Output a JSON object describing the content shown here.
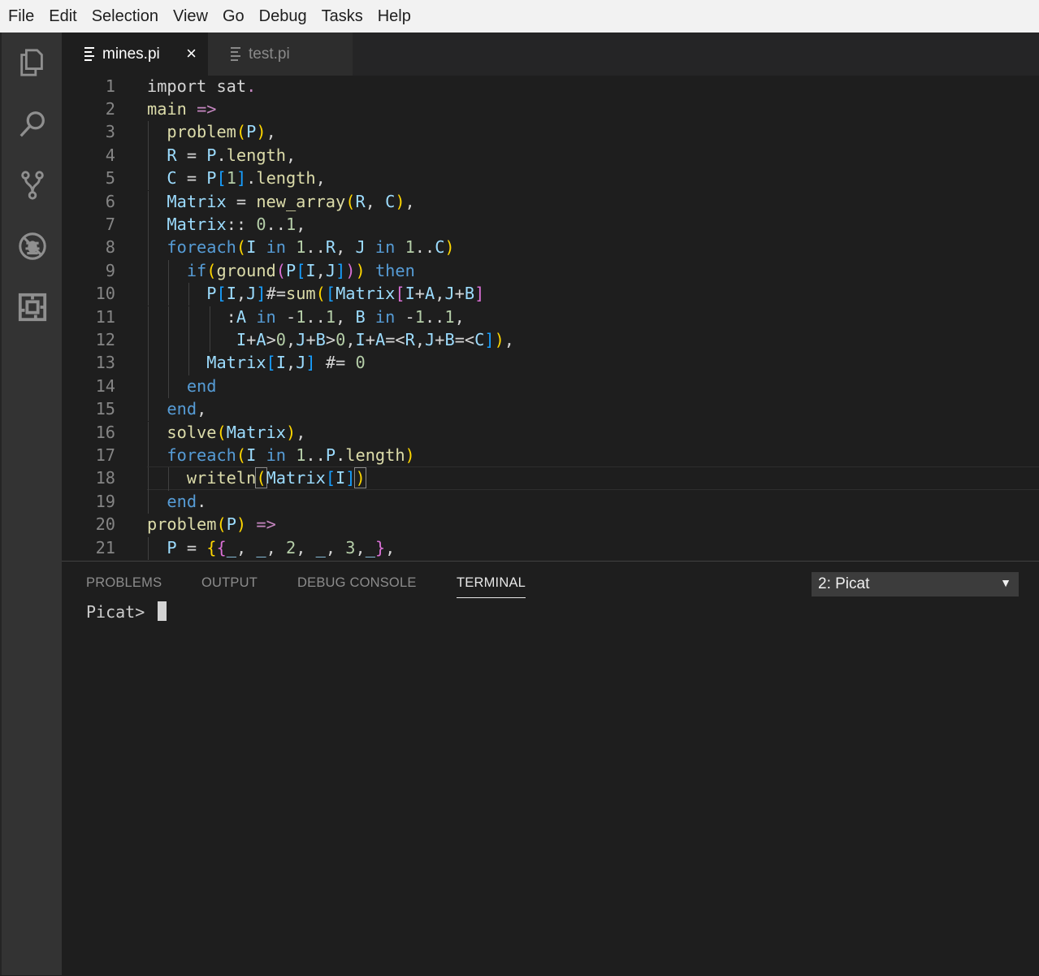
{
  "menu": [
    "File",
    "Edit",
    "Selection",
    "View",
    "Go",
    "Debug",
    "Tasks",
    "Help"
  ],
  "activity_bar": [
    "explorer-icon",
    "search-icon",
    "source-control-icon",
    "debug-icon",
    "extensions-icon"
  ],
  "tabs": [
    {
      "label": "mines.pi",
      "active": true,
      "close": "×"
    },
    {
      "label": "test.pi",
      "active": false
    }
  ],
  "editor": {
    "line_numbers": [
      "1",
      "2",
      "3",
      "4",
      "5",
      "6",
      "7",
      "8",
      "9",
      "10",
      "11",
      "12",
      "13",
      "14",
      "15",
      "16",
      "17",
      "18",
      "19",
      "20",
      "21"
    ],
    "current_line": 18,
    "lines": [
      [
        [
          "import sat",
          "txt"
        ],
        [
          ".",
          "kw"
        ]
      ],
      [
        [
          "main",
          "fn"
        ],
        [
          " ",
          "txt"
        ],
        [
          "=>",
          "kw"
        ]
      ],
      [
        [
          "  ",
          "txt"
        ],
        [
          "problem",
          "fn"
        ],
        [
          "(",
          "b1"
        ],
        [
          "P",
          "var"
        ],
        [
          ")",
          "b1"
        ],
        [
          ",",
          "txt"
        ]
      ],
      [
        [
          "  ",
          "txt"
        ],
        [
          "R",
          "var"
        ],
        [
          " = ",
          "txt"
        ],
        [
          "P",
          "var"
        ],
        [
          ".",
          "txt"
        ],
        [
          "length",
          "fn"
        ],
        [
          ",",
          "txt"
        ]
      ],
      [
        [
          "  ",
          "txt"
        ],
        [
          "C",
          "var"
        ],
        [
          " = ",
          "txt"
        ],
        [
          "P",
          "var"
        ],
        [
          "[",
          "b3"
        ],
        [
          "1",
          "num"
        ],
        [
          "]",
          "b3"
        ],
        [
          ".",
          "txt"
        ],
        [
          "length",
          "fn"
        ],
        [
          ",",
          "txt"
        ]
      ],
      [
        [
          "  ",
          "txt"
        ],
        [
          "Matrix",
          "var"
        ],
        [
          " = ",
          "txt"
        ],
        [
          "new_array",
          "fn"
        ],
        [
          "(",
          "b1"
        ],
        [
          "R",
          "var"
        ],
        [
          ", ",
          "txt"
        ],
        [
          "C",
          "var"
        ],
        [
          ")",
          "b1"
        ],
        [
          ",",
          "txt"
        ]
      ],
      [
        [
          "  ",
          "txt"
        ],
        [
          "Matrix",
          "var"
        ],
        [
          ":: ",
          "txt"
        ],
        [
          "0",
          "num"
        ],
        [
          "..",
          "txt"
        ],
        [
          "1",
          "num"
        ],
        [
          ",",
          "txt"
        ]
      ],
      [
        [
          "  ",
          "txt"
        ],
        [
          "foreach",
          "ctl"
        ],
        [
          "(",
          "b1"
        ],
        [
          "I",
          "var"
        ],
        [
          " ",
          "txt"
        ],
        [
          "in",
          "ctl"
        ],
        [
          " ",
          "txt"
        ],
        [
          "1",
          "num"
        ],
        [
          "..",
          "txt"
        ],
        [
          "R",
          "var"
        ],
        [
          ", ",
          "txt"
        ],
        [
          "J",
          "var"
        ],
        [
          " ",
          "txt"
        ],
        [
          "in",
          "ctl"
        ],
        [
          " ",
          "txt"
        ],
        [
          "1",
          "num"
        ],
        [
          "..",
          "txt"
        ],
        [
          "C",
          "var"
        ],
        [
          ")",
          "b1"
        ]
      ],
      [
        [
          "    ",
          "txt"
        ],
        [
          "if",
          "ctl"
        ],
        [
          "(",
          "b1"
        ],
        [
          "ground",
          "fn"
        ],
        [
          "(",
          "b2"
        ],
        [
          "P",
          "var"
        ],
        [
          "[",
          "b3"
        ],
        [
          "I",
          "var"
        ],
        [
          ",",
          "txt"
        ],
        [
          "J",
          "var"
        ],
        [
          "]",
          "b3"
        ],
        [
          ")",
          "b2"
        ],
        [
          ")",
          "b1"
        ],
        [
          " ",
          "txt"
        ],
        [
          "then",
          "ctl"
        ]
      ],
      [
        [
          "      ",
          "txt"
        ],
        [
          "P",
          "var"
        ],
        [
          "[",
          "b3"
        ],
        [
          "I",
          "var"
        ],
        [
          ",",
          "txt"
        ],
        [
          "J",
          "var"
        ],
        [
          "]",
          "b3"
        ],
        [
          "#=",
          "txt"
        ],
        [
          "sum",
          "fn"
        ],
        [
          "(",
          "b1"
        ],
        [
          "[",
          "b3"
        ],
        [
          "Matrix",
          "var"
        ],
        [
          "[",
          "b2"
        ],
        [
          "I",
          "var"
        ],
        [
          "+",
          "txt"
        ],
        [
          "A",
          "var"
        ],
        [
          ",",
          "txt"
        ],
        [
          "J",
          "var"
        ],
        [
          "+",
          "txt"
        ],
        [
          "B",
          "var"
        ],
        [
          "]",
          "b2"
        ]
      ],
      [
        [
          "        :",
          "txt"
        ],
        [
          "A",
          "var"
        ],
        [
          " ",
          "txt"
        ],
        [
          "in",
          "ctl"
        ],
        [
          " -",
          "txt"
        ],
        [
          "1",
          "num"
        ],
        [
          "..",
          "txt"
        ],
        [
          "1",
          "num"
        ],
        [
          ", ",
          "txt"
        ],
        [
          "B",
          "var"
        ],
        [
          " ",
          "txt"
        ],
        [
          "in",
          "ctl"
        ],
        [
          " -",
          "txt"
        ],
        [
          "1",
          "num"
        ],
        [
          "..",
          "txt"
        ],
        [
          "1",
          "num"
        ],
        [
          ",",
          "txt"
        ]
      ],
      [
        [
          "         ",
          "txt"
        ],
        [
          "I",
          "var"
        ],
        [
          "+",
          "txt"
        ],
        [
          "A",
          "var"
        ],
        [
          ">",
          "txt"
        ],
        [
          "0",
          "num"
        ],
        [
          ",",
          "txt"
        ],
        [
          "J",
          "var"
        ],
        [
          "+",
          "txt"
        ],
        [
          "B",
          "var"
        ],
        [
          ">",
          "txt"
        ],
        [
          "0",
          "num"
        ],
        [
          ",",
          "txt"
        ],
        [
          "I",
          "var"
        ],
        [
          "+",
          "txt"
        ],
        [
          "A",
          "var"
        ],
        [
          "=<",
          "txt"
        ],
        [
          "R",
          "var"
        ],
        [
          ",",
          "txt"
        ],
        [
          "J",
          "var"
        ],
        [
          "+",
          "txt"
        ],
        [
          "B",
          "var"
        ],
        [
          "=<",
          "txt"
        ],
        [
          "C",
          "var"
        ],
        [
          "]",
          "b3"
        ],
        [
          ")",
          "b1"
        ],
        [
          ",",
          "txt"
        ]
      ],
      [
        [
          "      ",
          "txt"
        ],
        [
          "Matrix",
          "var"
        ],
        [
          "[",
          "b3"
        ],
        [
          "I",
          "var"
        ],
        [
          ",",
          "txt"
        ],
        [
          "J",
          "var"
        ],
        [
          "]",
          "b3"
        ],
        [
          " #= ",
          "txt"
        ],
        [
          "0",
          "num"
        ]
      ],
      [
        [
          "    ",
          "txt"
        ],
        [
          "end",
          "ctl"
        ]
      ],
      [
        [
          "  ",
          "txt"
        ],
        [
          "end",
          "ctl"
        ],
        [
          ",",
          "txt"
        ]
      ],
      [
        [
          "  ",
          "txt"
        ],
        [
          "solve",
          "fn"
        ],
        [
          "(",
          "b1"
        ],
        [
          "Matrix",
          "var"
        ],
        [
          ")",
          "b1"
        ],
        [
          ",",
          "txt"
        ]
      ],
      [
        [
          "  ",
          "txt"
        ],
        [
          "foreach",
          "ctl"
        ],
        [
          "(",
          "b1"
        ],
        [
          "I",
          "var"
        ],
        [
          " ",
          "txt"
        ],
        [
          "in",
          "ctl"
        ],
        [
          " ",
          "txt"
        ],
        [
          "1",
          "num"
        ],
        [
          "..",
          "txt"
        ],
        [
          "P",
          "var"
        ],
        [
          ".",
          "txt"
        ],
        [
          "length",
          "fn"
        ],
        [
          ")",
          "b1"
        ]
      ],
      [
        [
          "    ",
          "txt"
        ],
        [
          "writeln",
          "fn"
        ],
        [
          "(",
          "b2m"
        ],
        [
          "Matrix",
          "var"
        ],
        [
          "[",
          "b3"
        ],
        [
          "I",
          "var"
        ],
        [
          "]",
          "b3"
        ],
        [
          ")",
          "b2m"
        ]
      ],
      [
        [
          "  ",
          "txt"
        ],
        [
          "end",
          "ctl"
        ],
        [
          ".",
          "txt"
        ]
      ],
      [
        [
          "problem",
          "fn"
        ],
        [
          "(",
          "b1"
        ],
        [
          "P",
          "var"
        ],
        [
          ")",
          "b1"
        ],
        [
          " ",
          "txt"
        ],
        [
          "=>",
          "kw"
        ]
      ],
      [
        [
          "  ",
          "txt"
        ],
        [
          "P",
          "var"
        ],
        [
          " = ",
          "txt"
        ],
        [
          "{",
          "b1"
        ],
        [
          "{",
          "b2"
        ],
        [
          "_",
          "var"
        ],
        [
          ", ",
          "txt"
        ],
        [
          "_",
          "var"
        ],
        [
          ", ",
          "txt"
        ],
        [
          "2",
          "num"
        ],
        [
          ", ",
          "txt"
        ],
        [
          "_",
          "var"
        ],
        [
          ", ",
          "txt"
        ],
        [
          "3",
          "num"
        ],
        [
          ",",
          "txt"
        ],
        [
          "_",
          "var"
        ],
        [
          "}",
          "b2"
        ],
        [
          ",",
          "txt"
        ]
      ]
    ]
  },
  "panel": {
    "tabs": [
      "PROBLEMS",
      "OUTPUT",
      "DEBUG CONSOLE",
      "TERMINAL"
    ],
    "active_tab": "TERMINAL",
    "terminal_select": "2: Picat",
    "terminal_select_arrow": "▼",
    "prompt": "Picat> "
  }
}
